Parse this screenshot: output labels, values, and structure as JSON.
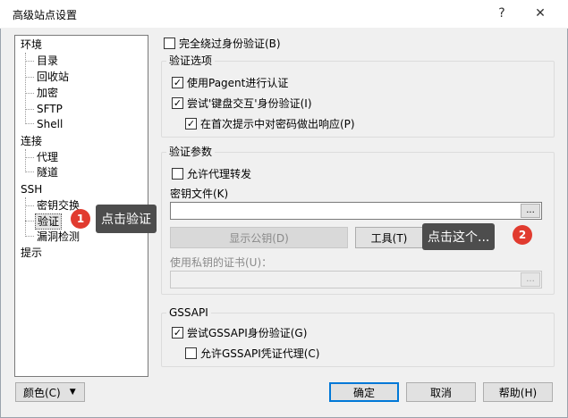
{
  "window": {
    "title": "高级站点设置",
    "help_glyph": "?",
    "close_glyph": "✕"
  },
  "tree": {
    "items": [
      {
        "label": "环境",
        "level": 0
      },
      {
        "label": "目录",
        "level": 1
      },
      {
        "label": "回收站",
        "level": 1
      },
      {
        "label": "加密",
        "level": 1
      },
      {
        "label": "SFTP",
        "level": 1
      },
      {
        "label": "Shell",
        "level": 1
      },
      {
        "label": "连接",
        "level": 0
      },
      {
        "label": "代理",
        "level": 1
      },
      {
        "label": "隧道",
        "level": 1
      },
      {
        "label": "SSH",
        "level": 0
      },
      {
        "label": "密钥交换",
        "level": 1
      },
      {
        "label": "验证",
        "level": 1,
        "selected": true
      },
      {
        "label": "漏洞检测",
        "level": 1
      },
      {
        "label": "提示",
        "level": 0
      }
    ]
  },
  "options": {
    "bypass_auth": {
      "label": "完全绕过身份验证(B)",
      "checked": false
    },
    "auth_group": {
      "title": "验证选项",
      "pageant": {
        "label": "使用Pagent进行认证",
        "checked": true
      },
      "keyboard_interactive": {
        "label": "尝试'键盘交互'身份验证(I)",
        "checked": true
      },
      "respond_password": {
        "label": "在首次提示中对密码做出响应(P)",
        "checked": true
      }
    },
    "params_group": {
      "title": "验证参数",
      "agent_forwarding": {
        "label": "允许代理转发",
        "checked": false
      },
      "key_file_label": "密钥文件(K)",
      "key_file_value": "",
      "browse_label": "...",
      "show_pubkey_label": "显示公钥(D)",
      "tools_label": "工具(T)",
      "cert_label": "使用私钥的证书(U)：",
      "cert_value": "",
      "cert_browse_label": "..."
    },
    "gssapi_group": {
      "title": "GSSAPI",
      "try_gssapi": {
        "label": "尝试GSSAPI身份验证(G)",
        "checked": true
      },
      "delegation": {
        "label": "允许GSSAPI凭证代理(C)",
        "checked": false
      }
    }
  },
  "footer": {
    "color_label": "颜色(C)",
    "ok_label": "确定",
    "cancel_label": "取消",
    "help_label": "帮助(H)"
  },
  "annotations": {
    "tip1": {
      "text": "点击验证",
      "badge": "1"
    },
    "tip2": {
      "text": "点击这个...",
      "badge": "2"
    }
  },
  "colors": {
    "accent": "#0078d7",
    "badge": "#e13b2f",
    "tooltip_bg": "#4d4d4d"
  }
}
